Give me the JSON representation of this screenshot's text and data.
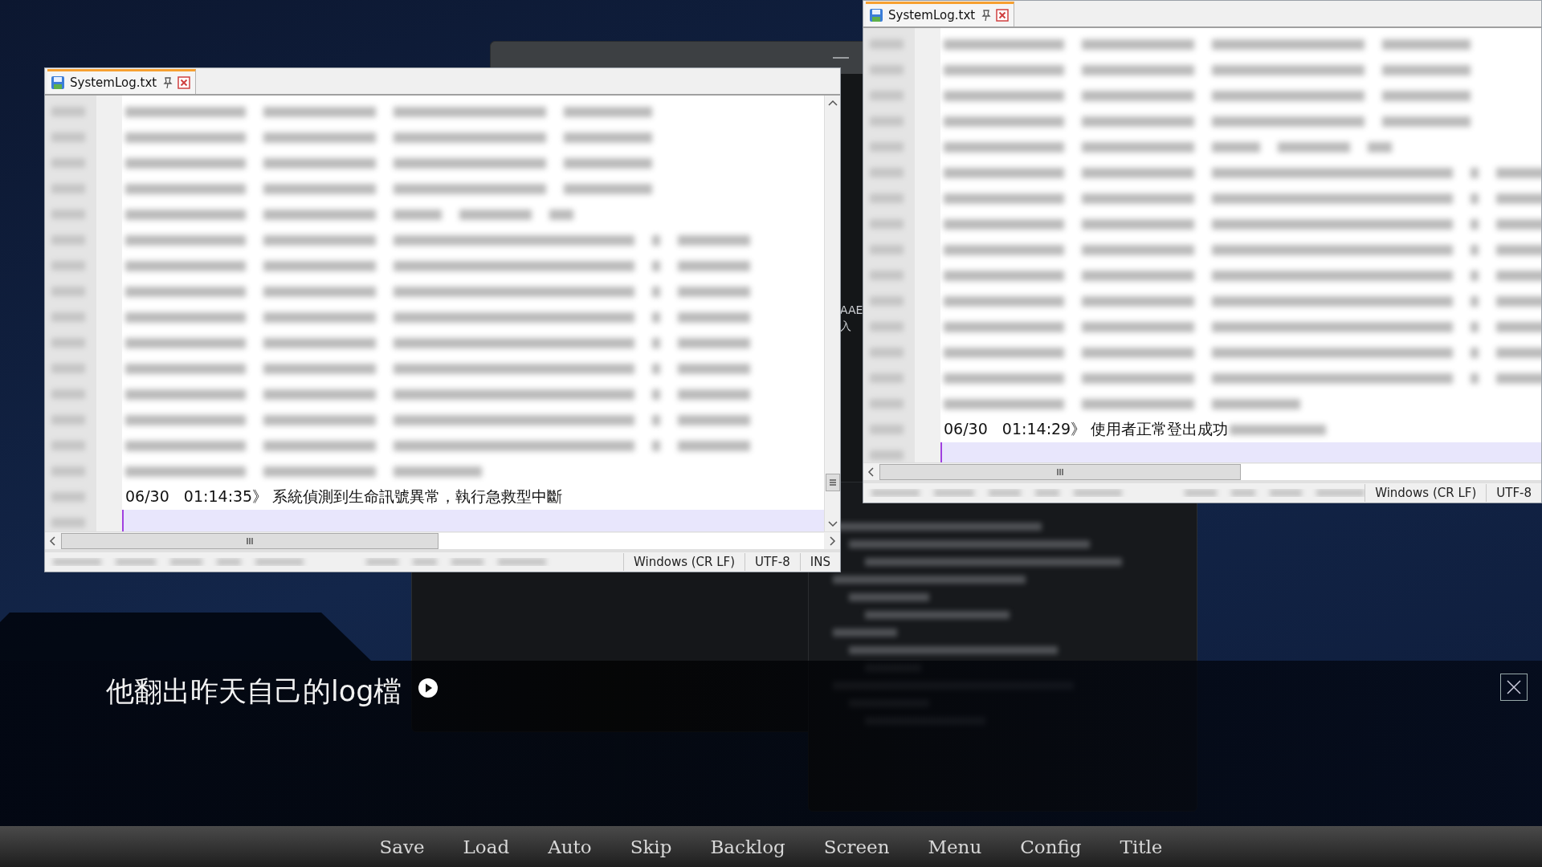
{
  "background_window": {
    "fragments": [
      "AAE",
      "入"
    ]
  },
  "editors": [
    {
      "tab": {
        "title": "SystemLog.txt"
      },
      "last_line": "06/30   01:14:35》 系統偵測到生命訊號異常，執行急救型中斷",
      "status": {
        "line_ending": "Windows (CR LF)",
        "encoding": "UTF-8",
        "mode": "INS"
      }
    },
    {
      "tab": {
        "title": "SystemLog.txt"
      },
      "last_line": "06/30   01:14:29》 使用者正常登出成功",
      "status": {
        "line_ending": "Windows (CR LF)",
        "encoding": "UTF-8"
      }
    }
  ],
  "dialog": {
    "text": "他翻出昨天自己的log檔"
  },
  "menu": [
    {
      "label": "Save"
    },
    {
      "label": "Load"
    },
    {
      "label": "Auto"
    },
    {
      "label": "Skip"
    },
    {
      "label": "Backlog"
    },
    {
      "label": "Screen"
    },
    {
      "label": "Menu"
    },
    {
      "label": "Config"
    },
    {
      "label": "Title"
    }
  ]
}
